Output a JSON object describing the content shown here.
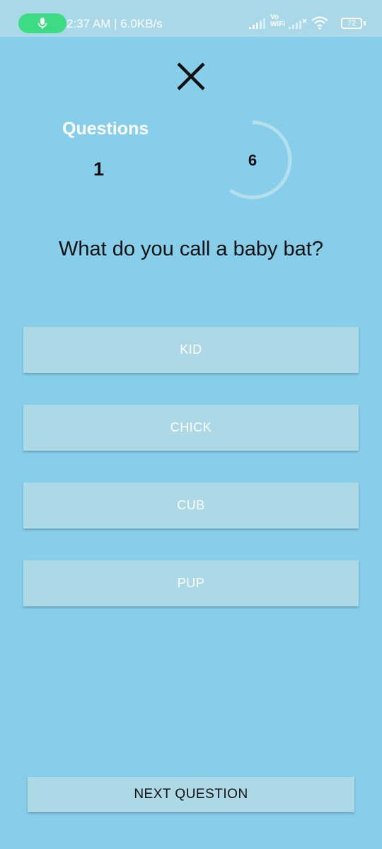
{
  "status_bar": {
    "time_speed": "2:37 AM | 6.0KB/s",
    "vowifi": "Vo\nWiFi",
    "battery": "72"
  },
  "header": {
    "close_icon": "close-icon",
    "questions_label": "Questions",
    "question_number": "1",
    "timer_value": "6",
    "timer_progress": 0.6
  },
  "question": {
    "text": "What do you call a baby bat?"
  },
  "answers": [
    {
      "label": "KID"
    },
    {
      "label": "CHICK"
    },
    {
      "label": "CUB"
    },
    {
      "label": "PUP"
    }
  ],
  "footer": {
    "next_label": "NEXT QUESTION"
  },
  "colors": {
    "background": "#87ceeb",
    "button": "#add8e6",
    "status_bar": "#a9d9e8",
    "mic_pill": "#3ddc84"
  }
}
